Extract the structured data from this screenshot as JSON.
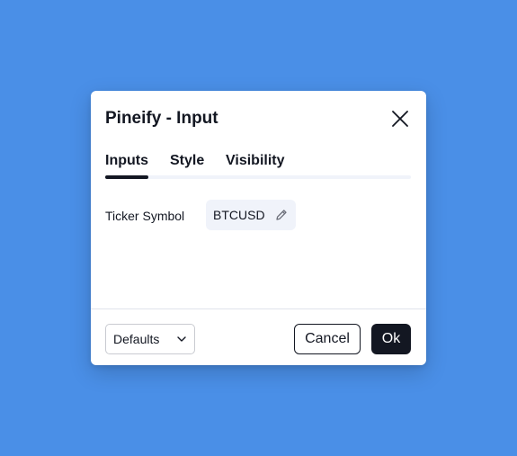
{
  "dialog": {
    "title": "Pineify - Input",
    "close_icon": "close-icon"
  },
  "tabs": [
    {
      "label": "Inputs",
      "active": true
    },
    {
      "label": "Style",
      "active": false
    },
    {
      "label": "Visibility",
      "active": false
    }
  ],
  "inputs": {
    "ticker_label": "Ticker Symbol",
    "ticker_value": "BTCUSD",
    "edit_icon": "pencil-icon"
  },
  "footer": {
    "defaults_label": "Defaults",
    "dropdown_icon": "chevron-down-icon",
    "cancel_label": "Cancel",
    "ok_label": "Ok"
  },
  "colors": {
    "background": "#4a8fe7",
    "dialog": "#ffffff",
    "text": "#131722",
    "tab_track": "#f0f3fa",
    "symbol_bg": "#f0f3fa",
    "primary_button": "#131722"
  }
}
